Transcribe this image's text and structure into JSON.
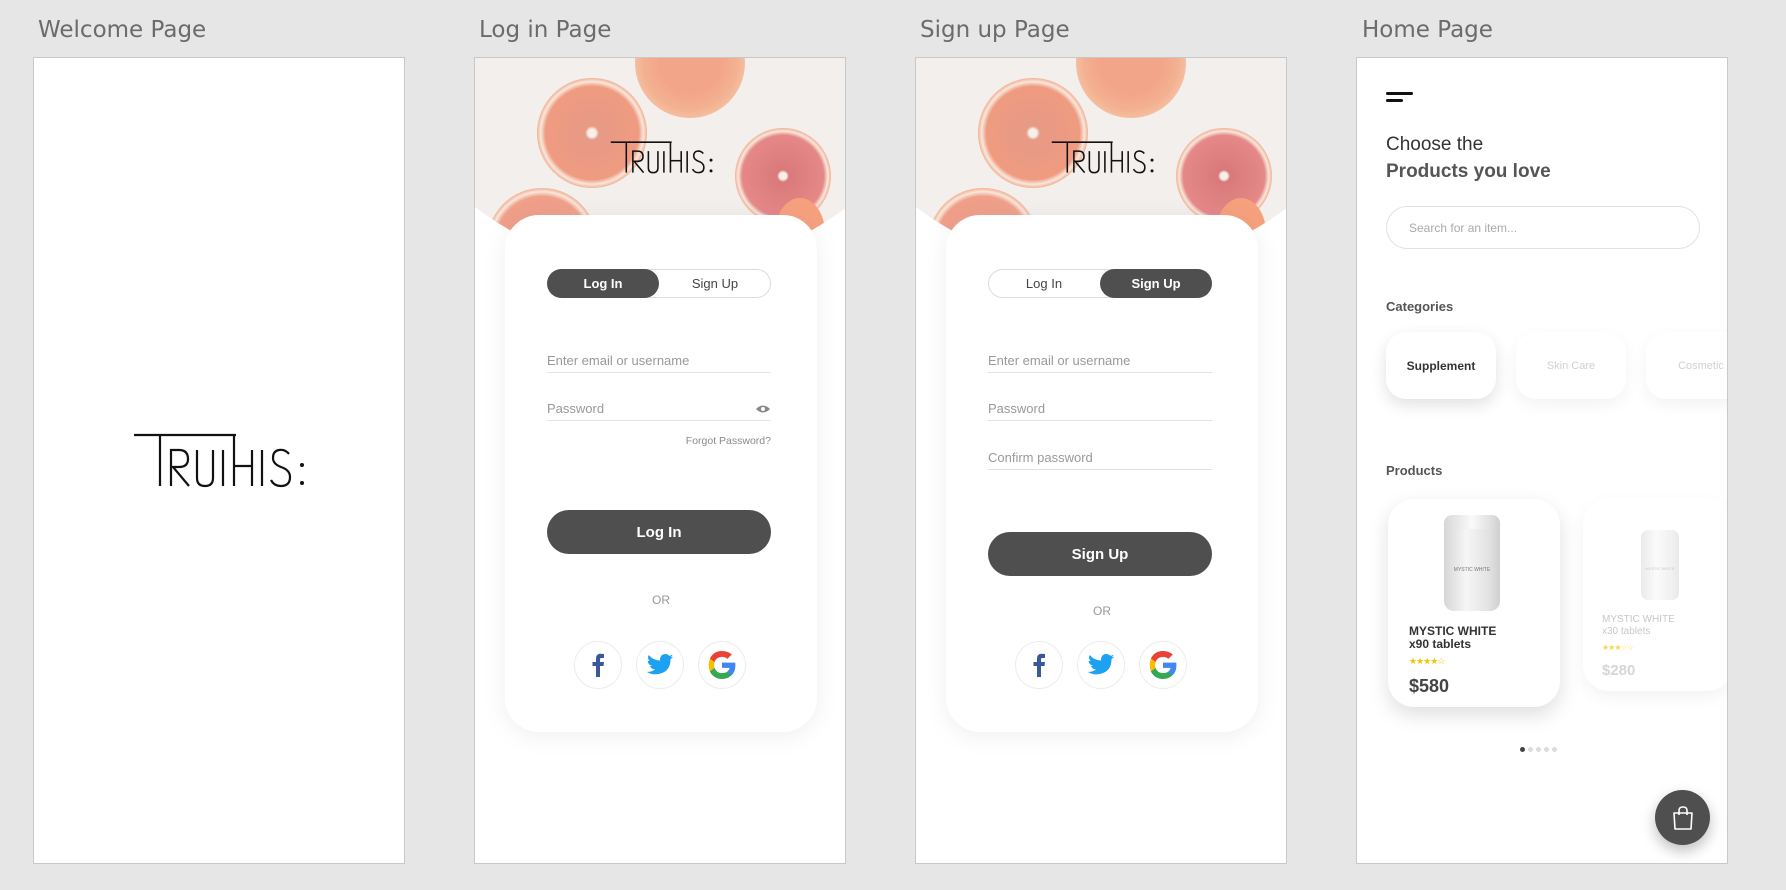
{
  "frames": {
    "welcome": {
      "label": "Welcome Page",
      "logo_alt": "Truthis logo"
    },
    "login": {
      "label": "Log in Page",
      "tabs": [
        "Log In",
        "Sign Up"
      ],
      "active_tab": "Log In",
      "email_placeholder": "Enter email or username",
      "password_placeholder": "Password",
      "forgot": "Forgot Password?",
      "submit": "Log In",
      "or": "OR"
    },
    "signup": {
      "label": "Sign up Page",
      "tabs": [
        "Log In",
        "Sign Up"
      ],
      "active_tab": "Sign Up",
      "email_placeholder": "Enter email or username",
      "password_placeholder": "Password",
      "confirm_placeholder": "Confirm password",
      "submit": "Sign Up",
      "or": "OR"
    },
    "home": {
      "label": "Home Page",
      "heading_line1": "Choose the",
      "heading_line2": "Products you love",
      "search_placeholder": "Search for an item...",
      "categories_title": "Categories",
      "categories": [
        "Supplement",
        "Skin Care",
        "Cosmetic"
      ],
      "active_category": "Supplement",
      "products_title": "Products",
      "products": [
        {
          "name_line1": "MYSTIC WHITE",
          "name_line2": "x90 tablets",
          "rating": 4,
          "price": "$580",
          "label": "MYSTIC WHITE"
        },
        {
          "name_line1": "MYSTIC WHITE",
          "name_line2": "x30 tablets",
          "rating": 3,
          "price": "$280",
          "label": "MYSTIC WHITE"
        }
      ],
      "carousel_pages": 5,
      "carousel_active": 1
    }
  },
  "colors": {
    "background": "#e6e6e6",
    "primary_button": "#4f4f4f",
    "star": "#f5c400",
    "facebook": "#3b5998",
    "twitter": "#1da1f2"
  },
  "icons": [
    "menu-icon",
    "eye-icon",
    "facebook-icon",
    "twitter-icon",
    "google-icon",
    "shopping-bag-icon",
    "star-icon"
  ]
}
